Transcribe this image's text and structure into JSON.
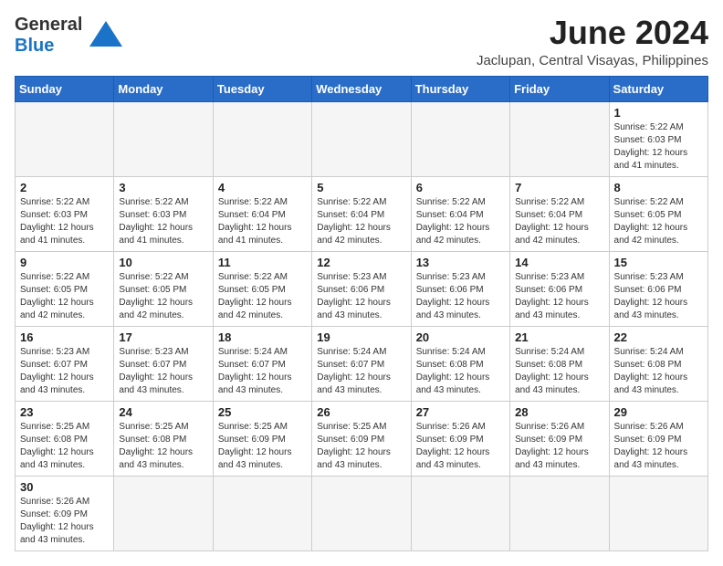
{
  "logo": {
    "line1": "General",
    "line2": "Blue"
  },
  "title": "June 2024",
  "subtitle": "Jaclupan, Central Visayas, Philippines",
  "weekdays": [
    "Sunday",
    "Monday",
    "Tuesday",
    "Wednesday",
    "Thursday",
    "Friday",
    "Saturday"
  ],
  "weeks": [
    [
      {
        "day": "",
        "empty": true
      },
      {
        "day": "",
        "empty": true
      },
      {
        "day": "",
        "empty": true
      },
      {
        "day": "",
        "empty": true
      },
      {
        "day": "",
        "empty": true
      },
      {
        "day": "",
        "empty": true
      },
      {
        "day": "1",
        "sunrise": "5:22 AM",
        "sunset": "6:03 PM",
        "daylight": "12 hours and 41 minutes."
      }
    ],
    [
      {
        "day": "2",
        "sunrise": "5:22 AM",
        "sunset": "6:03 PM",
        "daylight": "12 hours and 41 minutes."
      },
      {
        "day": "3",
        "sunrise": "5:22 AM",
        "sunset": "6:03 PM",
        "daylight": "12 hours and 41 minutes."
      },
      {
        "day": "4",
        "sunrise": "5:22 AM",
        "sunset": "6:04 PM",
        "daylight": "12 hours and 41 minutes."
      },
      {
        "day": "5",
        "sunrise": "5:22 AM",
        "sunset": "6:04 PM",
        "daylight": "12 hours and 42 minutes."
      },
      {
        "day": "6",
        "sunrise": "5:22 AM",
        "sunset": "6:04 PM",
        "daylight": "12 hours and 42 minutes."
      },
      {
        "day": "7",
        "sunrise": "5:22 AM",
        "sunset": "6:04 PM",
        "daylight": "12 hours and 42 minutes."
      },
      {
        "day": "8",
        "sunrise": "5:22 AM",
        "sunset": "6:05 PM",
        "daylight": "12 hours and 42 minutes."
      }
    ],
    [
      {
        "day": "9",
        "sunrise": "5:22 AM",
        "sunset": "6:05 PM",
        "daylight": "12 hours and 42 minutes."
      },
      {
        "day": "10",
        "sunrise": "5:22 AM",
        "sunset": "6:05 PM",
        "daylight": "12 hours and 42 minutes."
      },
      {
        "day": "11",
        "sunrise": "5:22 AM",
        "sunset": "6:05 PM",
        "daylight": "12 hours and 42 minutes."
      },
      {
        "day": "12",
        "sunrise": "5:23 AM",
        "sunset": "6:06 PM",
        "daylight": "12 hours and 43 minutes."
      },
      {
        "day": "13",
        "sunrise": "5:23 AM",
        "sunset": "6:06 PM",
        "daylight": "12 hours and 43 minutes."
      },
      {
        "day": "14",
        "sunrise": "5:23 AM",
        "sunset": "6:06 PM",
        "daylight": "12 hours and 43 minutes."
      },
      {
        "day": "15",
        "sunrise": "5:23 AM",
        "sunset": "6:06 PM",
        "daylight": "12 hours and 43 minutes."
      }
    ],
    [
      {
        "day": "16",
        "sunrise": "5:23 AM",
        "sunset": "6:07 PM",
        "daylight": "12 hours and 43 minutes."
      },
      {
        "day": "17",
        "sunrise": "5:23 AM",
        "sunset": "6:07 PM",
        "daylight": "12 hours and 43 minutes."
      },
      {
        "day": "18",
        "sunrise": "5:24 AM",
        "sunset": "6:07 PM",
        "daylight": "12 hours and 43 minutes."
      },
      {
        "day": "19",
        "sunrise": "5:24 AM",
        "sunset": "6:07 PM",
        "daylight": "12 hours and 43 minutes."
      },
      {
        "day": "20",
        "sunrise": "5:24 AM",
        "sunset": "6:08 PM",
        "daylight": "12 hours and 43 minutes."
      },
      {
        "day": "21",
        "sunrise": "5:24 AM",
        "sunset": "6:08 PM",
        "daylight": "12 hours and 43 minutes."
      },
      {
        "day": "22",
        "sunrise": "5:24 AM",
        "sunset": "6:08 PM",
        "daylight": "12 hours and 43 minutes."
      }
    ],
    [
      {
        "day": "23",
        "sunrise": "5:25 AM",
        "sunset": "6:08 PM",
        "daylight": "12 hours and 43 minutes."
      },
      {
        "day": "24",
        "sunrise": "5:25 AM",
        "sunset": "6:08 PM",
        "daylight": "12 hours and 43 minutes."
      },
      {
        "day": "25",
        "sunrise": "5:25 AM",
        "sunset": "6:09 PM",
        "daylight": "12 hours and 43 minutes."
      },
      {
        "day": "26",
        "sunrise": "5:25 AM",
        "sunset": "6:09 PM",
        "daylight": "12 hours and 43 minutes."
      },
      {
        "day": "27",
        "sunrise": "5:26 AM",
        "sunset": "6:09 PM",
        "daylight": "12 hours and 43 minutes."
      },
      {
        "day": "28",
        "sunrise": "5:26 AM",
        "sunset": "6:09 PM",
        "daylight": "12 hours and 43 minutes."
      },
      {
        "day": "29",
        "sunrise": "5:26 AM",
        "sunset": "6:09 PM",
        "daylight": "12 hours and 43 minutes."
      }
    ],
    [
      {
        "day": "30",
        "sunrise": "5:26 AM",
        "sunset": "6:09 PM",
        "daylight": "12 hours and 43 minutes."
      },
      {
        "day": "",
        "empty": true
      },
      {
        "day": "",
        "empty": true
      },
      {
        "day": "",
        "empty": true
      },
      {
        "day": "",
        "empty": true
      },
      {
        "day": "",
        "empty": true
      },
      {
        "day": "",
        "empty": true
      }
    ]
  ],
  "labels": {
    "sunrise": "Sunrise:",
    "sunset": "Sunset:",
    "daylight": "Daylight:"
  }
}
